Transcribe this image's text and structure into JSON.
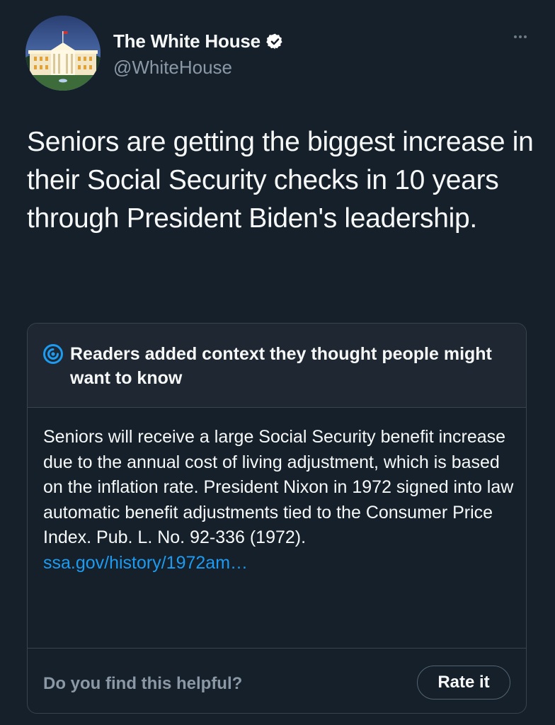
{
  "tweet": {
    "author": {
      "display_name": "The White House",
      "handle": "@WhiteHouse",
      "verified": true,
      "avatar_icon": "white-house-avatar"
    },
    "more_icon": "more-options-icon",
    "text": "Seniors are getting the biggest increase in their Social Security checks in 10 years through President Biden's leadership."
  },
  "community_note": {
    "icon": "community-notes-icon",
    "title": "Readers added context they thought people might want to know",
    "body": "Seniors will receive a large Social Security benefit increase due to the annual cost of living adjustment, which is based on the inflation rate. President Nixon in 1972 signed into law automatic benefit adjustments tied to the Consumer Price Index. Pub. L. No. 92-336 (1972).",
    "link_text": "ssa.gov/history/1972am…",
    "helpful_question": "Do you find this helpful?",
    "rate_button_label": "Rate it"
  },
  "colors": {
    "background": "#15202b",
    "note_header_background": "#1e2732",
    "border": "#38444d",
    "primary_text": "#f7f9f9",
    "secondary_text": "#8b98a5",
    "link": "#1d9bf0",
    "verified_badge": "#ffffff"
  }
}
